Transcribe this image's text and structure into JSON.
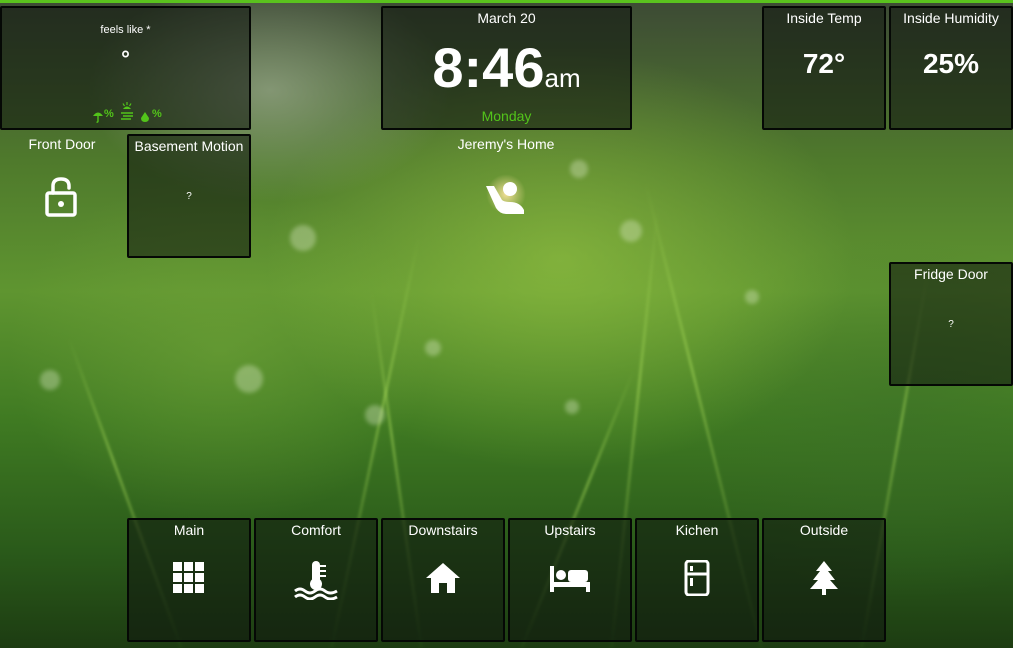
{
  "weather": {
    "feels_like_label": "feels like *",
    "temp_symbol": "°",
    "precip_suffix": "%",
    "humidity_suffix": "%"
  },
  "clock": {
    "date": "March 20",
    "time": "8:46",
    "ampm": "am",
    "day": "Monday"
  },
  "inside_temp": {
    "title": "Inside Temp",
    "value": "72°"
  },
  "inside_humidity": {
    "title": "Inside Humidity",
    "value": "25%"
  },
  "front_door": {
    "title": "Front Door"
  },
  "basement_motion": {
    "title": "Basement Motion",
    "value": "?"
  },
  "home": {
    "title": "Jeremy's Home"
  },
  "fridge_door": {
    "title": "Fridge Door",
    "value": "?"
  },
  "nav": [
    {
      "label": "Main",
      "icon": "grid-icon"
    },
    {
      "label": "Comfort",
      "icon": "thermometer-water-icon"
    },
    {
      "label": "Downstairs",
      "icon": "house-icon"
    },
    {
      "label": "Upstairs",
      "icon": "bed-icon"
    },
    {
      "label": "Kichen",
      "icon": "fridge-icon"
    },
    {
      "label": "Outside",
      "icon": "pine-tree-icon"
    }
  ],
  "colors": {
    "accent": "#52c41a",
    "tile_border": "#050805"
  }
}
